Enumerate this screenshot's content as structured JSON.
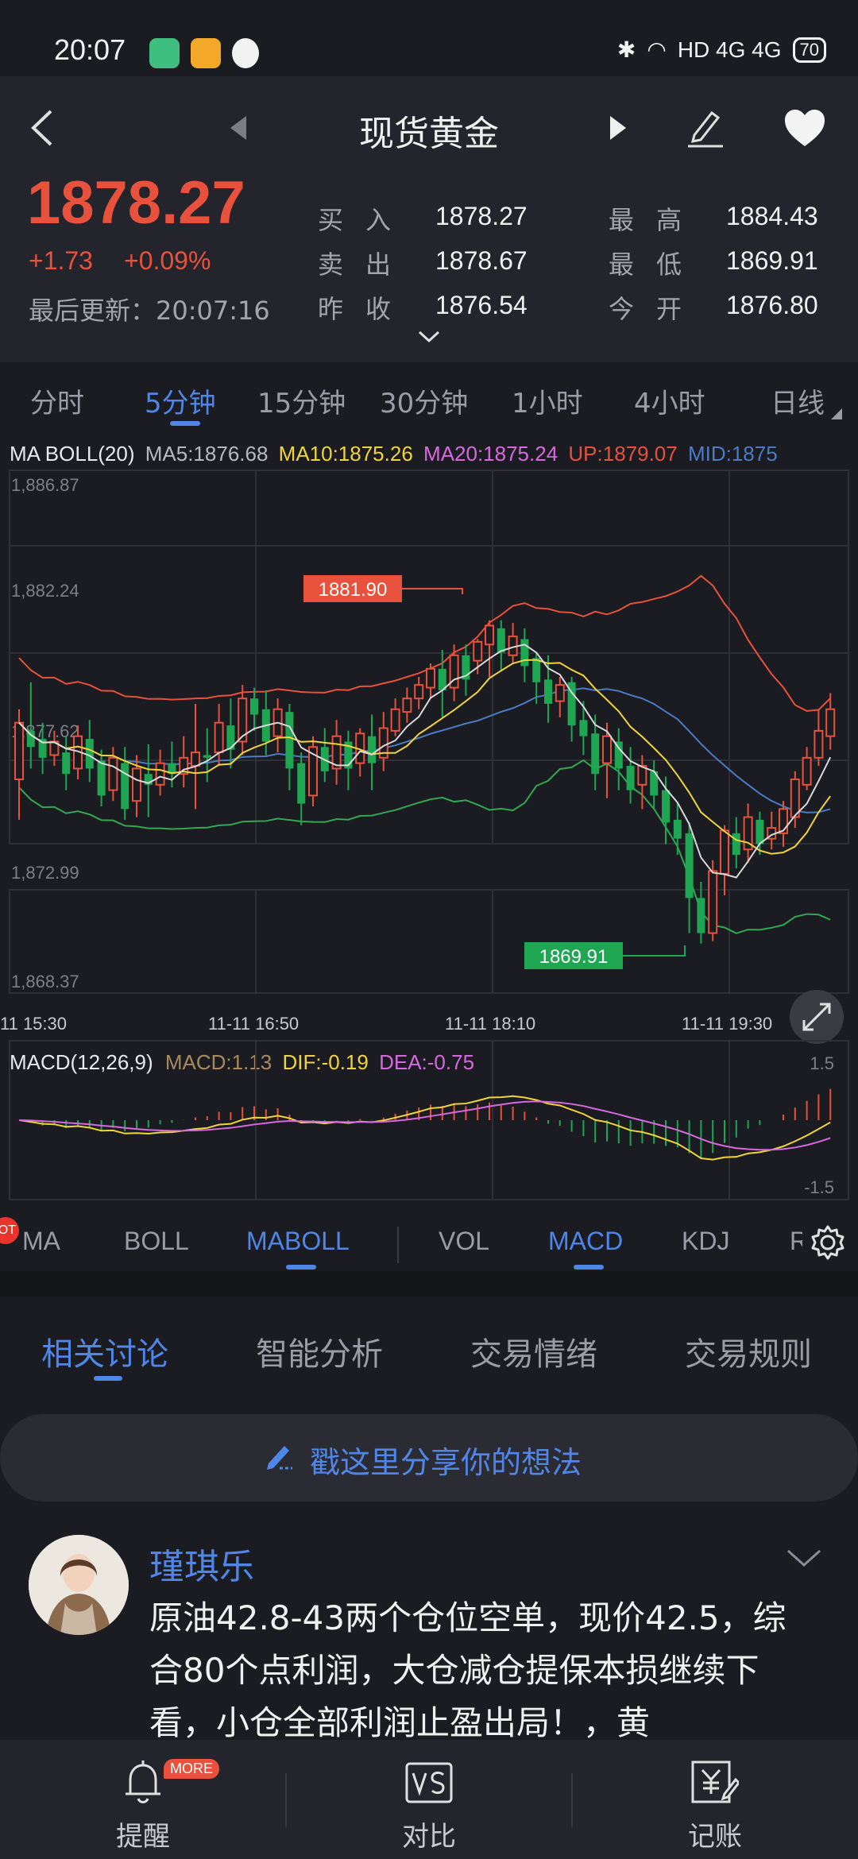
{
  "status_bar": {
    "time": "20:07",
    "network": "HD 4G 4G",
    "battery": "70"
  },
  "header": {
    "title": "现货黄金",
    "price": "1878.27",
    "change": "+1.73",
    "change_pct": "+0.09%",
    "last_update": "最后更新：20:07:16",
    "quotes": {
      "buy_label": "买入",
      "buy": "1878.27",
      "sell_label": "卖出",
      "sell": "1878.67",
      "prev_close_label": "昨收",
      "prev_close": "1876.54",
      "high_label": "最高",
      "high": "1884.43",
      "low_label": "最低",
      "low": "1869.91",
      "open_label": "今开",
      "open": "1876.80"
    }
  },
  "periods": [
    "分时",
    "5分钟",
    "15分钟",
    "30分钟",
    "1小时",
    "4小时",
    "日线"
  ],
  "active_period": "5分钟",
  "main_chart": {
    "legend_name": "MA BOLL(20)",
    "ma5": "MA5:1876.68",
    "ma10": "MA10:1875.26",
    "ma20": "MA20:1875.24",
    "up": "UP:1879.07",
    "mid": "MID:1875",
    "y_ticks": [
      "1,886.87",
      "1,882.24",
      "1,877.62",
      "1,872.99",
      "1,868.37"
    ],
    "x_ticks": [
      "11 15:30",
      "11-11 16:50",
      "11-11 18:10",
      "11-11 19:30"
    ],
    "high_marker": "1881.90",
    "low_marker": "1869.91"
  },
  "macd_chart": {
    "legend_name": "MACD(12,26,9)",
    "macd": "MACD:1.13",
    "dif": "DIF:-0.19",
    "dea": "DEA:-0.75",
    "top_tick": "1.5",
    "bottom_tick": "-1.5"
  },
  "colors": {
    "up": "#e8513c",
    "down": "#1fa653",
    "accent": "#4f86e8",
    "ma5": "#d9d9d9",
    "ma10": "#f0d43c",
    "ma20": "#d868e0",
    "boll_up": "#e8513c",
    "boll_mid": "#4a7bc4",
    "boll_low": "#32a852"
  },
  "indicators": [
    "MA",
    "BOLL",
    "MABOLL",
    "VOL",
    "MACD",
    "KDJ",
    "R"
  ],
  "ind_badge": "OT",
  "tabs": [
    "相关讨论",
    "智能分析",
    "交易情绪",
    "交易规则"
  ],
  "active_tab": "相关讨论",
  "share_placeholder": "戳这里分享你的想法",
  "post": {
    "author": "瑾琪乐",
    "text": "原油42.8-43两个仓位空单，现价42.5，综合80个点利润，大仓减仓提保本损继续下看，小仓全部利润止盈出局！，黄"
  },
  "bottom_nav": {
    "alert": "提醒",
    "compare": "对比",
    "ledger": "记账",
    "more_badge": "MORE"
  },
  "candles": [
    [
      1876.0,
      1878.1,
      1874.5,
      1878.6
    ],
    [
      1877.8,
      1877.2,
      1876.4,
      1879.6
    ],
    [
      1877.5,
      1876.8,
      1876.2,
      1878.1
    ],
    [
      1876.9,
      1877.4,
      1876.5,
      1877.8
    ],
    [
      1877.0,
      1876.2,
      1875.6,
      1877.6
    ],
    [
      1876.4,
      1877.6,
      1876.0,
      1878.0
    ],
    [
      1877.5,
      1876.4,
      1875.9,
      1878.2
    ],
    [
      1876.7,
      1875.4,
      1875.0,
      1877.1
    ],
    [
      1875.6,
      1876.8,
      1875.2,
      1877.2
    ],
    [
      1876.6,
      1874.9,
      1874.5,
      1877.2
    ],
    [
      1875.2,
      1876.4,
      1874.6,
      1876.9
    ],
    [
      1876.2,
      1875.8,
      1874.6,
      1877.3
    ],
    [
      1875.8,
      1876.6,
      1875.4,
      1877.1
    ],
    [
      1876.6,
      1876.2,
      1875.7,
      1877.4
    ],
    [
      1876.2,
      1876.8,
      1875.7,
      1877.6
    ],
    [
      1876.5,
      1877.0,
      1874.9,
      1878.8
    ],
    [
      1876.9,
      1876.8,
      1875.9,
      1877.9
    ],
    [
      1877.0,
      1878.1,
      1876.5,
      1878.8
    ],
    [
      1878.0,
      1877.1,
      1876.4,
      1879.0
    ],
    [
      1877.4,
      1879.0,
      1876.9,
      1879.5
    ],
    [
      1879.0,
      1878.4,
      1877.8,
      1879.4
    ],
    [
      1878.6,
      1877.4,
      1876.9,
      1879.3
    ],
    [
      1877.6,
      1878.6,
      1877.0,
      1879.0
    ],
    [
      1878.5,
      1876.4,
      1875.6,
      1878.8
    ],
    [
      1876.6,
      1875.1,
      1874.3,
      1877.0
    ],
    [
      1875.4,
      1877.2,
      1875.0,
      1877.6
    ],
    [
      1877.2,
      1876.3,
      1875.9,
      1877.9
    ],
    [
      1876.4,
      1877.6,
      1875.8,
      1878.2
    ],
    [
      1877.4,
      1876.4,
      1875.6,
      1877.8
    ],
    [
      1876.6,
      1877.7,
      1876.1,
      1877.9
    ],
    [
      1877.6,
      1876.6,
      1875.6,
      1878.4
    ],
    [
      1876.8,
      1877.9,
      1876.3,
      1878.5
    ],
    [
      1877.8,
      1878.6,
      1877.6,
      1879.0
    ],
    [
      1878.5,
      1879.0,
      1878.1,
      1879.4
    ],
    [
      1879.0,
      1879.5,
      1878.6,
      1879.8
    ],
    [
      1879.4,
      1880.1,
      1879.0,
      1880.3
    ],
    [
      1880.1,
      1879.3,
      1878.3,
      1880.8
    ],
    [
      1879.4,
      1880.6,
      1878.9,
      1881.0
    ],
    [
      1880.6,
      1879.7,
      1879.1,
      1881.0
    ],
    [
      1880.4,
      1881.1,
      1879.9,
      1881.2
    ],
    [
      1881.0,
      1881.7,
      1879.8,
      1881.9
    ],
    [
      1881.6,
      1880.7,
      1880.0,
      1881.9
    ],
    [
      1880.6,
      1881.3,
      1880.3,
      1881.8
    ],
    [
      1881.2,
      1880.2,
      1879.6,
      1881.6
    ],
    [
      1880.5,
      1879.6,
      1878.8,
      1880.7
    ],
    [
      1879.7,
      1878.8,
      1878.1,
      1880.6
    ],
    [
      1878.9,
      1879.5,
      1878.3,
      1879.8
    ],
    [
      1879.6,
      1878.0,
      1877.4,
      1879.8
    ],
    [
      1878.2,
      1877.6,
      1876.9,
      1878.9
    ],
    [
      1877.7,
      1876.2,
      1875.6,
      1878.4
    ],
    [
      1876.6,
      1877.6,
      1875.3,
      1878.1
    ],
    [
      1877.4,
      1876.4,
      1875.6,
      1877.9
    ],
    [
      1876.5,
      1875.6,
      1875.1,
      1877.2
    ],
    [
      1875.8,
      1876.5,
      1874.9,
      1876.9
    ],
    [
      1876.3,
      1875.4,
      1874.9,
      1876.7
    ],
    [
      1875.6,
      1874.4,
      1873.6,
      1876.1
    ],
    [
      1874.5,
      1873.8,
      1873.2,
      1875.1
    ],
    [
      1874.0,
      1871.6,
      1870.3,
      1874.4
    ],
    [
      1871.6,
      1870.3,
      1869.91,
      1872.2
    ],
    [
      1870.3,
      1872.6,
      1870.0,
      1873.0
    ],
    [
      1872.5,
      1874.1,
      1871.7,
      1874.3
    ],
    [
      1874.0,
      1873.2,
      1872.7,
      1874.6
    ],
    [
      1873.4,
      1874.6,
      1872.9,
      1875.1
    ],
    [
      1874.5,
      1873.6,
      1873.2,
      1874.8
    ],
    [
      1873.8,
      1874.2,
      1873.4,
      1874.8
    ],
    [
      1874.0,
      1874.9,
      1873.5,
      1875.2
    ],
    [
      1874.6,
      1876.0,
      1874.2,
      1876.3
    ],
    [
      1875.8,
      1876.8,
      1875.6,
      1877.2
    ],
    [
      1876.8,
      1877.8,
      1876.5,
      1878.6
    ],
    [
      1877.6,
      1878.6,
      1877.1,
      1879.2
    ]
  ]
}
